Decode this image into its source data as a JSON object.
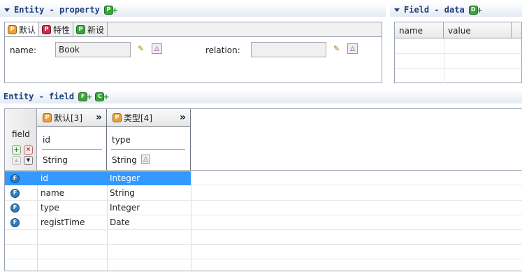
{
  "entity_property": {
    "title": "Entity - property",
    "tabs": [
      {
        "badge": "P",
        "label": "默认"
      },
      {
        "badge": "P",
        "label": "特性"
      },
      {
        "badge": "P",
        "label": "新设"
      }
    ],
    "name_label": "name:",
    "name_value": "Book",
    "relation_label": "relation:",
    "relation_value": ""
  },
  "field_data": {
    "title": "Field - data",
    "columns": [
      "name",
      "value"
    ]
  },
  "entity_field": {
    "title": "Entity - field",
    "row_header": "field",
    "groups": [
      {
        "badge": "P",
        "label": "默认[3]",
        "expand": "»",
        "col_name": "id",
        "col_type": "String"
      },
      {
        "badge": "P",
        "label": "类型[4]",
        "expand": "»",
        "col_name": "type",
        "col_type": "String"
      }
    ],
    "rows": [
      {
        "badge": "F",
        "name": "id",
        "type": "Integer",
        "selected": true
      },
      {
        "badge": "F",
        "name": "name",
        "type": "String",
        "selected": false
      },
      {
        "badge": "F",
        "name": "type",
        "type": "Integer",
        "selected": false
      },
      {
        "badge": "F",
        "name": "registTime",
        "type": "Date",
        "selected": false
      }
    ]
  },
  "colors": {
    "selection": "#3399ff",
    "header_text": "#1f3f79"
  }
}
